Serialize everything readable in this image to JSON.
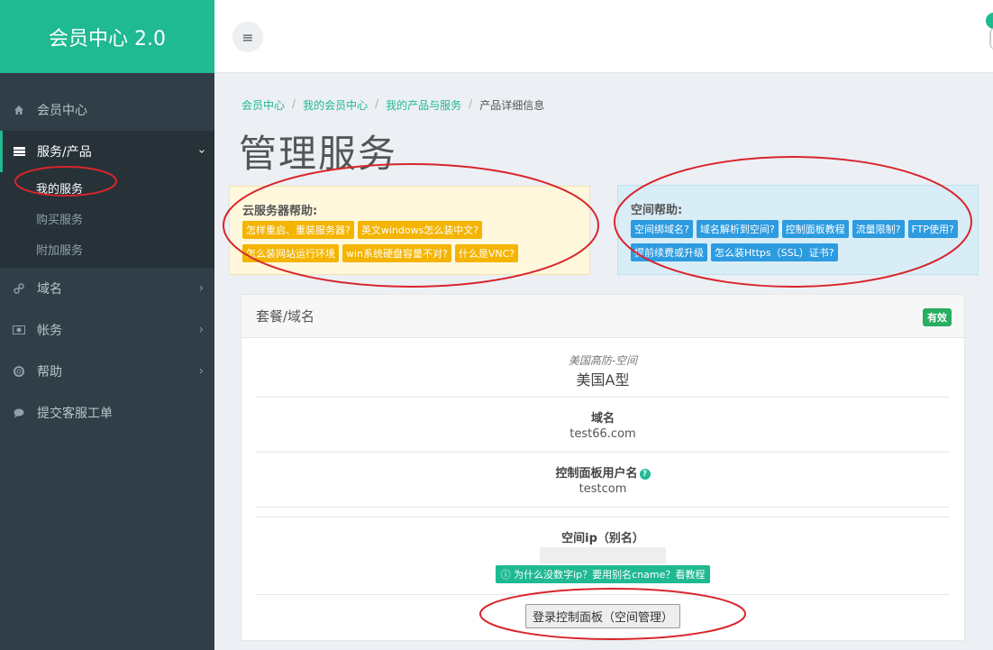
{
  "brand": "会员中心 2.0",
  "sidebar": {
    "items": [
      {
        "label": "会员中心",
        "icon": "home-icon"
      },
      {
        "label": "服务/产品",
        "icon": "server-icon"
      },
      {
        "label": "域名",
        "icon": "link-icon"
      },
      {
        "label": "帐务",
        "icon": "money-icon"
      },
      {
        "label": "帮助",
        "icon": "lifebuoy-icon"
      },
      {
        "label": "提交客服工单",
        "icon": "comment-icon"
      }
    ],
    "sub_items": [
      "我的服务",
      "购买服务",
      "附加服务"
    ]
  },
  "breadcrumb": [
    "会员中心",
    "我的会员中心",
    "我的产品与服务",
    "产品详细信息"
  ],
  "page_title": "管理服务",
  "cloud_help": {
    "title": "云服务器帮助:",
    "tags": [
      "怎样重启、重装服务器?",
      "英文windows怎么装中文?",
      "怎么装网站运行环境",
      "win系统硬盘容量不对?",
      "什么是VNC?"
    ]
  },
  "space_help": {
    "title": "空间帮助:",
    "tags": [
      "空间绑域名?",
      "域名解析到空间?",
      "控制面板教程",
      "流量限制?",
      "FTP使用?",
      "提前续费或升级",
      "怎么装Https（SSL）证书?"
    ]
  },
  "panel": {
    "title": "套餐/域名",
    "status": "有效",
    "package_type": "美国高防-空间",
    "package_name": "美国A型",
    "domain_label": "域名",
    "domain_value": "test66.com",
    "username_label": "控制面板用户名",
    "username_value": "testcom",
    "ip_label": "空间ip（别名）",
    "cname_tip": "为什么没数字ip？要用别名cname？看教程",
    "login_button": "登录控制面板（空间管理）"
  },
  "colors": {
    "accent": "#1fb992",
    "sidebar_bg": "#2f3e47",
    "warning_tag": "#f4b400",
    "info_tag": "#2d9be0",
    "annotation": "#d9252b"
  }
}
